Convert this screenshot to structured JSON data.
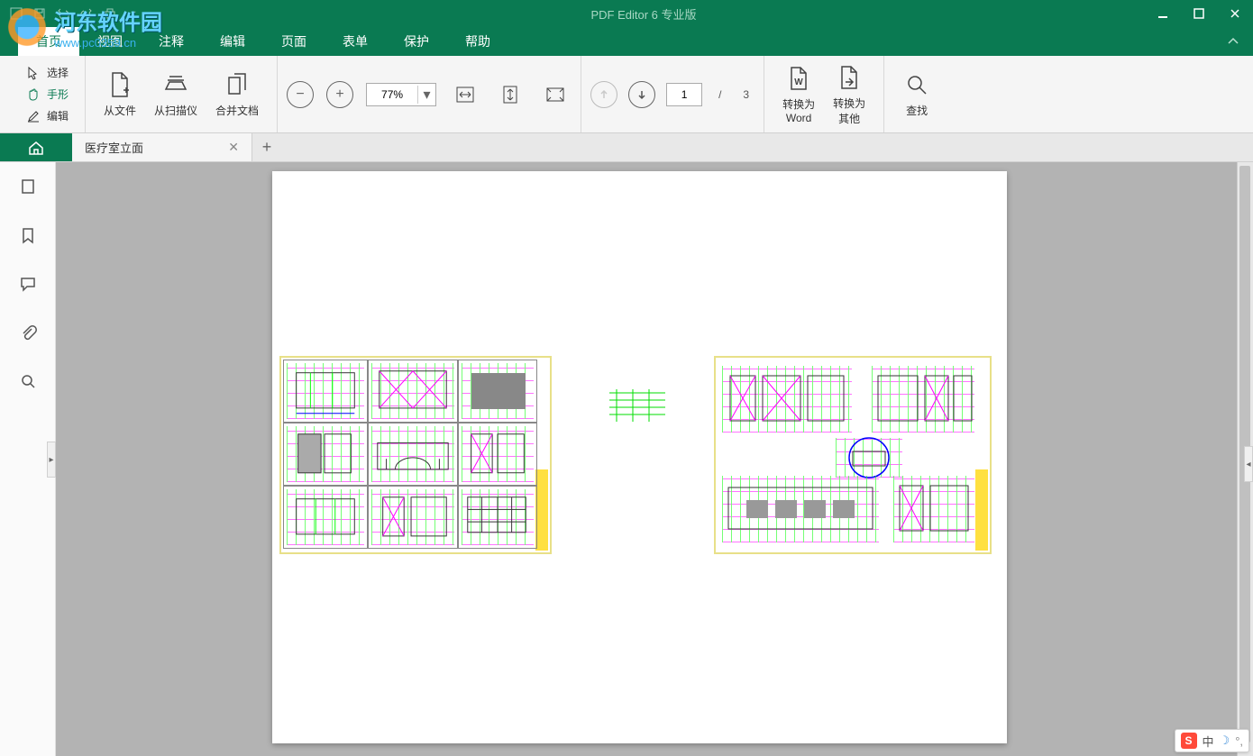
{
  "app": {
    "title": "PDF Editor 6 专业版"
  },
  "watermark": {
    "line1": "河东软件园",
    "line2": "www.pc0359.cn"
  },
  "menu": {
    "items": [
      "首页",
      "视图",
      "注释",
      "编辑",
      "页面",
      "表单",
      "保护",
      "帮助"
    ],
    "active_index": 0
  },
  "ribbon": {
    "mode": {
      "select": "选择",
      "hand": "手形",
      "edit": "编辑"
    },
    "create": {
      "from_file": "从文件",
      "from_scanner": "从扫描仪",
      "merge": "合并文档"
    },
    "zoom": {
      "value": "77%"
    },
    "pages": {
      "current": "1",
      "total": "3",
      "sep": "/"
    },
    "convert": {
      "to_word": "转换为\nWord",
      "to_other": "转换为\n其他"
    },
    "find": "查找"
  },
  "tabs": {
    "doc_name": "医疗室立面"
  },
  "ime": {
    "brand": "S",
    "lang": "中"
  }
}
